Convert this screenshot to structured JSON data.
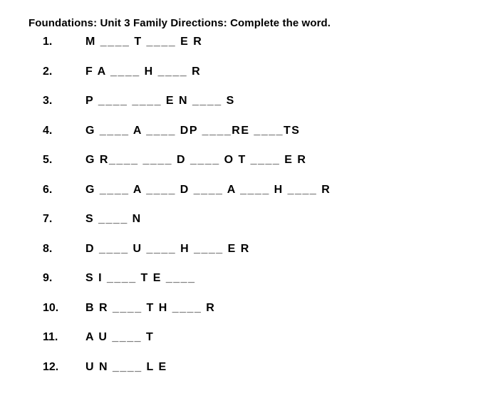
{
  "worksheet": {
    "title": "Foundations: Unit 3 Family Directions: Complete the word.",
    "items": [
      {
        "number": "1.",
        "word": "M ____ T ____ E R"
      },
      {
        "number": "2.",
        "word": "F A ____ H ____ R"
      },
      {
        "number": "3.",
        "word": "P ____ ____ E N ____ S"
      },
      {
        "number": "4.",
        "word": "G ____ A ____ DP ____RE ____TS"
      },
      {
        "number": "5.",
        "word": "G R____ ____ D ____ O T ____ E R"
      },
      {
        "number": "6.",
        "word": "G ____ A ____ D ____ A ____ H ____ R"
      },
      {
        "number": "7.",
        "word": "S ____ N"
      },
      {
        "number": "8.",
        "word": "D ____ U ____ H ____ E R"
      },
      {
        "number": "9.",
        "word": "S I ____ T E ____"
      },
      {
        "number": "10.",
        "word": "B R ____ T H ____ R"
      },
      {
        "number": "11.",
        "word": "A U ____ T"
      },
      {
        "number": "12.",
        "word": "U N ____ L E"
      }
    ]
  }
}
